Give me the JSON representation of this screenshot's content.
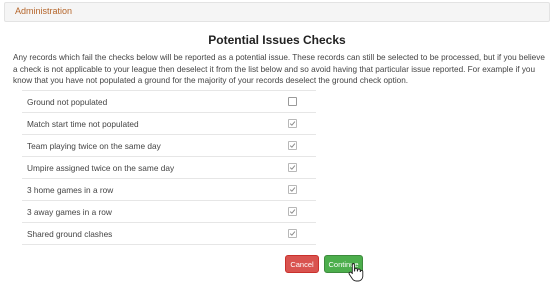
{
  "breadcrumb": {
    "label": "Administration"
  },
  "title": "Potential Issues Checks",
  "description": "Any records which fail the checks below will be reported as a potential issue. These records can still be selected to be processed, but if you believe a check is not applicable to your league then deselect it from the list below and so avoid having that particular issue reported. For example if you know that you have not populated a ground for the majority of your records deselect the ground check option.",
  "checks": [
    {
      "label": "Ground not populated",
      "checked": false
    },
    {
      "label": "Match start time not populated",
      "checked": true
    },
    {
      "label": "Team playing twice on the same day",
      "checked": true
    },
    {
      "label": "Umpire assigned twice on the same day",
      "checked": true
    },
    {
      "label": "3 home games in a row",
      "checked": true
    },
    {
      "label": "3 away games in a row",
      "checked": true
    },
    {
      "label": "Shared ground clashes",
      "checked": true
    }
  ],
  "buttons": {
    "cancel": "Cancel",
    "continue": "Continue"
  },
  "colors": {
    "cancel": "#d9534f",
    "continue": "#4cae4c",
    "breadcrumb_text": "#b5652a"
  },
  "icons": {
    "cursor": "hand-pointer-icon"
  }
}
